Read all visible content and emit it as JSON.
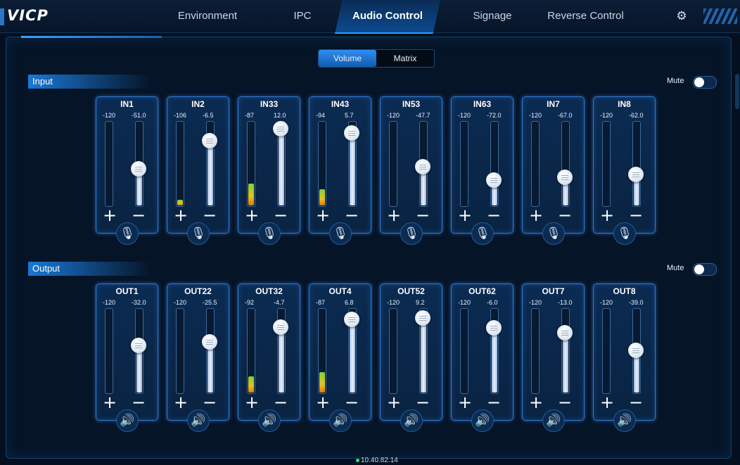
{
  "app": {
    "logo": "VICP"
  },
  "nav": {
    "tabs": [
      {
        "label": "Environment",
        "active": false
      },
      {
        "label": "IPC",
        "active": false
      },
      {
        "label": "Audio Control",
        "active": true
      },
      {
        "label": "Signage",
        "active": false
      },
      {
        "label": "Reverse Control",
        "active": false
      }
    ],
    "settings_icon": "gear-icon"
  },
  "view_switch": {
    "options": [
      "Volume",
      "Matrix"
    ],
    "selected": "Volume"
  },
  "input": {
    "title": "Input",
    "mute_label": "Mute",
    "mute_on": false,
    "channel_icon": "microphone-icon",
    "channels": [
      {
        "name": "IN1",
        "min": "-120",
        "value": "-51.0",
        "meter": 0.0,
        "fader": 0.42
      },
      {
        "name": "IN2",
        "min": "-106",
        "value": "-6.5",
        "meter": 0.07,
        "fader": 0.83
      },
      {
        "name": "IN33",
        "min": "-87",
        "value": "12.0",
        "meter": 0.27,
        "fader": 1.0
      },
      {
        "name": "IN43",
        "min": "-94",
        "value": "5.7",
        "meter": 0.2,
        "fader": 0.94
      },
      {
        "name": "IN53",
        "min": "-120",
        "value": "-47.7",
        "meter": 0.0,
        "fader": 0.45
      },
      {
        "name": "IN63",
        "min": "-120",
        "value": "-72.0",
        "meter": 0.0,
        "fader": 0.26
      },
      {
        "name": "IN7",
        "min": "-120",
        "value": "-67.0",
        "meter": 0.0,
        "fader": 0.3
      },
      {
        "name": "IN8",
        "min": "-120",
        "value": "-62.0",
        "meter": 0.0,
        "fader": 0.34
      }
    ]
  },
  "output": {
    "title": "Output",
    "mute_label": "Mute",
    "mute_on": false,
    "channel_icon": "speaker-icon",
    "channels": [
      {
        "name": "OUT1",
        "min": "-120",
        "value": "-32.0",
        "meter": 0.0,
        "fader": 0.57
      },
      {
        "name": "OUT22",
        "min": "-120",
        "value": "-25.5",
        "meter": 0.0,
        "fader": 0.62
      },
      {
        "name": "OUT32",
        "min": "-92",
        "value": "-4.7",
        "meter": 0.2,
        "fader": 0.84
      },
      {
        "name": "OUT4",
        "min": "-87",
        "value": "6.8",
        "meter": 0.25,
        "fader": 0.95
      },
      {
        "name": "OUT52",
        "min": "-120",
        "value": "9.2",
        "meter": 0.0,
        "fader": 0.97
      },
      {
        "name": "OUT62",
        "min": "-120",
        "value": "-6.0",
        "meter": 0.0,
        "fader": 0.83
      },
      {
        "name": "OUT7",
        "min": "-120",
        "value": "-13.0",
        "meter": 0.0,
        "fader": 0.76
      },
      {
        "name": "OUT8",
        "min": "-120",
        "value": "-39.0",
        "meter": 0.0,
        "fader": 0.5
      }
    ]
  },
  "status": {
    "ip": "10.40.82.14"
  },
  "colors": {
    "accent": "#2f8ef0",
    "panel_border": "#2d7ad0",
    "background": "#04101f"
  }
}
